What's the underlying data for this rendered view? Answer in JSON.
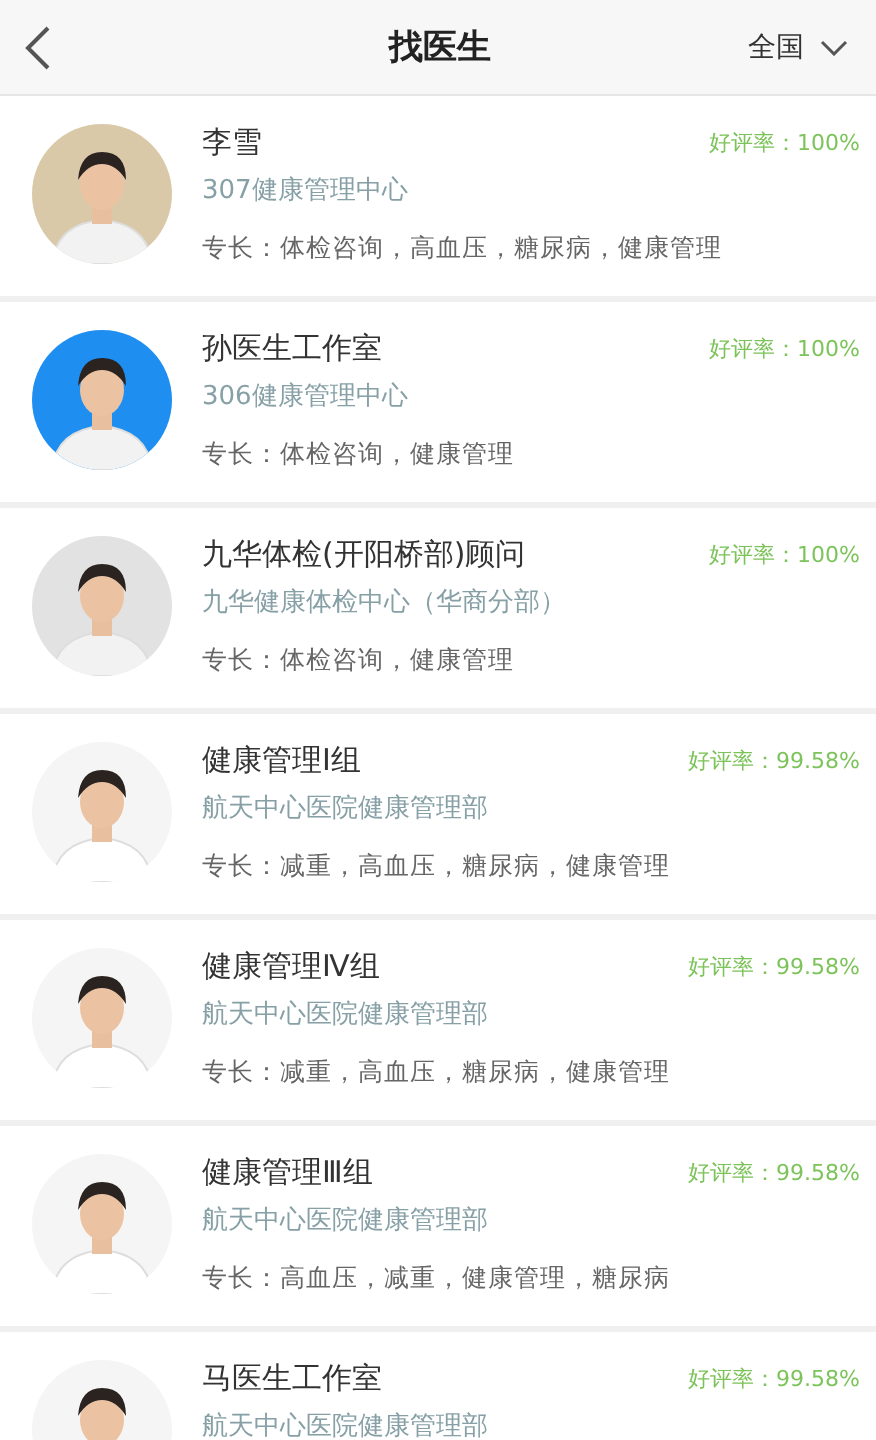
{
  "header": {
    "title": "找医生",
    "region": "全国"
  },
  "doctors": [
    {
      "name": "李雪",
      "hospital": "307健康管理中心",
      "rating": "好评率：100%",
      "specialty": "专长：体检咨询，高血压，糖尿病，健康管理"
    },
    {
      "name": "孙医生工作室",
      "hospital": "306健康管理中心",
      "rating": "好评率：100%",
      "specialty": "专长：体检咨询，健康管理"
    },
    {
      "name": "九华体检(开阳桥部)顾问",
      "hospital": "九华健康体检中心（华商分部）",
      "rating": "好评率：100%",
      "specialty": "专长：体检咨询，健康管理"
    },
    {
      "name": "健康管理Ⅰ组",
      "hospital": "航天中心医院健康管理部",
      "rating": "好评率：99.58%",
      "specialty": "专长：减重，高血压，糖尿病，健康管理"
    },
    {
      "name": "健康管理Ⅳ组",
      "hospital": "航天中心医院健康管理部",
      "rating": "好评率：99.58%",
      "specialty": "专长：减重，高血压，糖尿病，健康管理"
    },
    {
      "name": "健康管理Ⅲ组",
      "hospital": "航天中心医院健康管理部",
      "rating": "好评率：99.58%",
      "specialty": "专长：高血压，减重，健康管理，糖尿病"
    },
    {
      "name": "马医生工作室",
      "hospital": "航天中心医院健康管理部",
      "rating": "好评率：99.58%"
    }
  ]
}
